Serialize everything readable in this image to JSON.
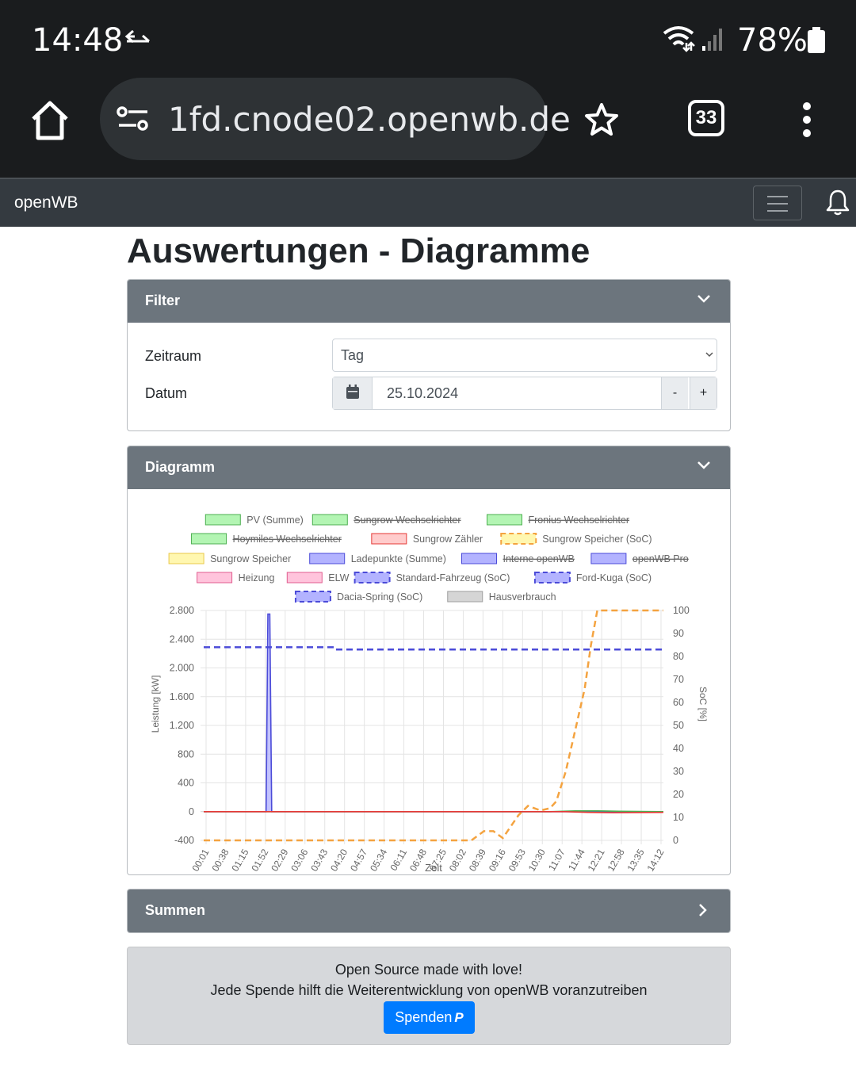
{
  "status_bar": {
    "time": "14:48",
    "battery": "78%"
  },
  "browser": {
    "url": "1fd.cnode02.openwb.de",
    "tab_count": "33"
  },
  "navbar": {
    "brand": "openWB"
  },
  "page_title": "Auswertungen - Diagramme",
  "filter": {
    "header": "Filter",
    "zeitraum_label": "Zeitraum",
    "zeitraum_value": "Tag",
    "datum_label": "Datum",
    "datum_value": "25.10.2024",
    "minus": "-",
    "plus": "+"
  },
  "diagram": {
    "header": "Diagramm"
  },
  "summen": {
    "header": "Summen"
  },
  "footer": {
    "line1": "Open Source made with love!",
    "line2": "Jede Spende hilft die Weiterentwicklung von openWB voranzutreiben",
    "button": "Spenden",
    "button_icon": "P"
  },
  "chart_data": {
    "type": "line",
    "xlabel": "Zeit",
    "ylabel": "Leistung [kW]",
    "y2label": "SoC [%]",
    "ylim": [
      -400,
      2800
    ],
    "y_ticks": [
      "2.800",
      "2.400",
      "2.000",
      "1.600",
      "1.200",
      "800",
      "400",
      "0",
      "-400"
    ],
    "y2lim": [
      0,
      100
    ],
    "y2_ticks": [
      "100",
      "90",
      "80",
      "70",
      "60",
      "50",
      "40",
      "30",
      "20",
      "10",
      "0"
    ],
    "x_ticks": [
      "00:01",
      "00:38",
      "01:15",
      "01:52",
      "02:29",
      "03:06",
      "03:43",
      "04:20",
      "04:57",
      "05:34",
      "06:11",
      "06:48",
      "07:25",
      "08:02",
      "08:39",
      "09:16",
      "09:53",
      "10:30",
      "11:07",
      "11:44",
      "12:21",
      "12:58",
      "13:35",
      "14:12"
    ],
    "grid": true,
    "legend_position": "top",
    "legend": [
      {
        "name": "PV (Summe)",
        "color": "#4caf50",
        "fill": "#b3f5b3",
        "dashed": false,
        "hidden": false
      },
      {
        "name": "Sungrow Wechselrichter",
        "color": "#4caf50",
        "fill": "#b3f5b3",
        "dashed": false,
        "hidden": true
      },
      {
        "name": "Fronius Wechselrichter",
        "color": "#4caf50",
        "fill": "#b3f5b3",
        "dashed": false,
        "hidden": true
      },
      {
        "name": "Hoymiles Wechselrichter",
        "color": "#4caf50",
        "fill": "#b3f5b3",
        "dashed": false,
        "hidden": true
      },
      {
        "name": "Sungrow Zähler",
        "color": "#e53935",
        "fill": "#ffcccc",
        "dashed": false,
        "hidden": false
      },
      {
        "name": "Sungrow Speicher (SoC)",
        "color": "#f4a340",
        "fill": "#fff7b0",
        "dashed": true,
        "hidden": false
      },
      {
        "name": "Sungrow Speicher",
        "color": "#e8c84a",
        "fill": "#fff7b0",
        "dashed": false,
        "hidden": false
      },
      {
        "name": "Ladepunkte (Summe)",
        "color": "#4b4bd8",
        "fill": "#b3b3ff",
        "dashed": false,
        "hidden": false
      },
      {
        "name": "Interne openWB",
        "color": "#4b4bd8",
        "fill": "#b3b3ff",
        "dashed": false,
        "hidden": true
      },
      {
        "name": "openWB Pro",
        "color": "#4b4bd8",
        "fill": "#b3b3ff",
        "dashed": false,
        "hidden": true
      },
      {
        "name": "Heizung",
        "color": "#e05d8f",
        "fill": "#ffc4dc",
        "dashed": false,
        "hidden": false
      },
      {
        "name": "ELW",
        "color": "#e05d8f",
        "fill": "#ffc4dc",
        "dashed": false,
        "hidden": false
      },
      {
        "name": "Standard-Fahrzeug (SoC)",
        "color": "#4b4bd8",
        "fill": "#b3b3ff",
        "dashed": true,
        "hidden": false
      },
      {
        "name": "Ford-Kuga (SoC)",
        "color": "#4b4bd8",
        "fill": "#b3b3ff",
        "dashed": true,
        "hidden": false
      },
      {
        "name": "Dacia-Spring (SoC)",
        "color": "#4b4bd8",
        "fill": "#b3b3ff",
        "dashed": true,
        "hidden": false
      },
      {
        "name": "Hausverbrauch",
        "color": "#9e9e9e",
        "fill": "#d5d5d5",
        "dashed": false,
        "hidden": false
      }
    ],
    "series": [
      {
        "name": "Ladepunkte (Summe)",
        "axis": "left",
        "color": "#4b4bd8",
        "dashed": false,
        "x_hours": [
          0,
          1.98,
          2.04,
          2.1,
          2.16,
          14.6
        ],
        "values": [
          0,
          0,
          2750,
          2750,
          0,
          0
        ]
      },
      {
        "name": "Standard-Fahrzeug (SoC)",
        "axis": "right",
        "color": "#4b4bd8",
        "dashed": true,
        "x_hours": [
          0,
          4.17,
          4.2,
          14.6
        ],
        "values": [
          84,
          84,
          83,
          83
        ]
      },
      {
        "name": "Sungrow Speicher (SoC)",
        "axis": "right",
        "color": "#f4a340",
        "dashed": true,
        "x_hours": [
          0,
          8.5,
          8.9,
          9.2,
          9.5,
          9.7,
          10.0,
          10.3,
          10.5,
          10.7,
          11.0,
          11.2,
          11.5,
          11.8,
          12.1,
          12.3,
          12.5,
          13.0,
          14.6
        ],
        "values": [
          0,
          0,
          4,
          4,
          1,
          5,
          11,
          15,
          14,
          13,
          14,
          17,
          30,
          48,
          66,
          85,
          100,
          100,
          100
        ]
      },
      {
        "name": "PV (Summe)",
        "axis": "left",
        "color": "#4caf50",
        "dashed": false,
        "x_hours": [
          0,
          11.0,
          11.8,
          12.5,
          13.2,
          14.6
        ],
        "values": [
          0,
          0,
          10,
          10,
          5,
          0
        ]
      },
      {
        "name": "Sungrow Zähler",
        "axis": "left",
        "color": "#e53935",
        "dashed": false,
        "x_hours": [
          0,
          11.5,
          12.2,
          13.0,
          14.6
        ],
        "values": [
          0,
          0,
          -10,
          -15,
          -10
        ]
      }
    ]
  }
}
